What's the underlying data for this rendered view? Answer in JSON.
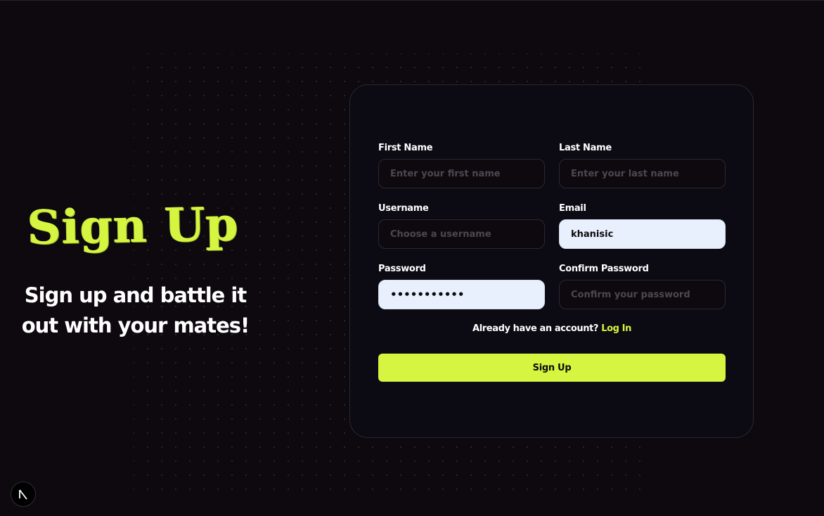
{
  "hero": {
    "title": "Sign Up",
    "subtitle": "Sign up and battle it out with your mates!"
  },
  "form": {
    "first_name": {
      "label": "First Name",
      "placeholder": "Enter your first name",
      "value": ""
    },
    "last_name": {
      "label": "Last Name",
      "placeholder": "Enter your last name",
      "value": ""
    },
    "username": {
      "label": "Username",
      "placeholder": "Choose a username",
      "value": ""
    },
    "email": {
      "label": "Email",
      "placeholder": "",
      "value": "khanisic"
    },
    "password": {
      "label": "Password",
      "placeholder": "",
      "value": "•••••••••••"
    },
    "confirm_password": {
      "label": "Confirm Password",
      "placeholder": "Confirm your password",
      "value": ""
    },
    "login_prompt": "Already have an account?",
    "login_link": "Log In",
    "submit_label": "Sign Up"
  },
  "badge": {
    "icon": "nextjs-logo-icon",
    "letter": "N"
  },
  "colors": {
    "background": "#0e090f",
    "card": "#0c0a12",
    "accent": "#d6f540",
    "autofill": "#e8f0fd"
  }
}
